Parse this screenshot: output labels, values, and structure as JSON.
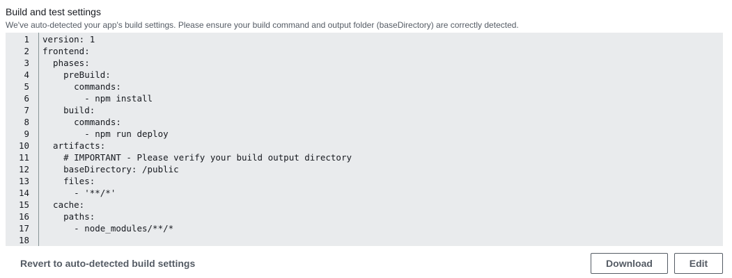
{
  "header": {
    "title": "Build and test settings",
    "description": "We've auto-detected your app's build settings. Please ensure your build command and output folder (baseDirectory) are correctly detected."
  },
  "editor": {
    "lines": [
      "version: 1",
      "frontend:",
      "  phases:",
      "    preBuild:",
      "      commands:",
      "        - npm install",
      "    build:",
      "      commands:",
      "        - npm run deploy",
      "  artifacts:",
      "    # IMPORTANT - Please verify your build output directory",
      "    baseDirectory: /public",
      "    files:",
      "      - '**/*'",
      "  cache:",
      "    paths:",
      "      - node_modules/**/*",
      ""
    ]
  },
  "actions": {
    "revert_label": "Revert to auto-detected build settings",
    "download_label": "Download",
    "edit_label": "Edit"
  }
}
